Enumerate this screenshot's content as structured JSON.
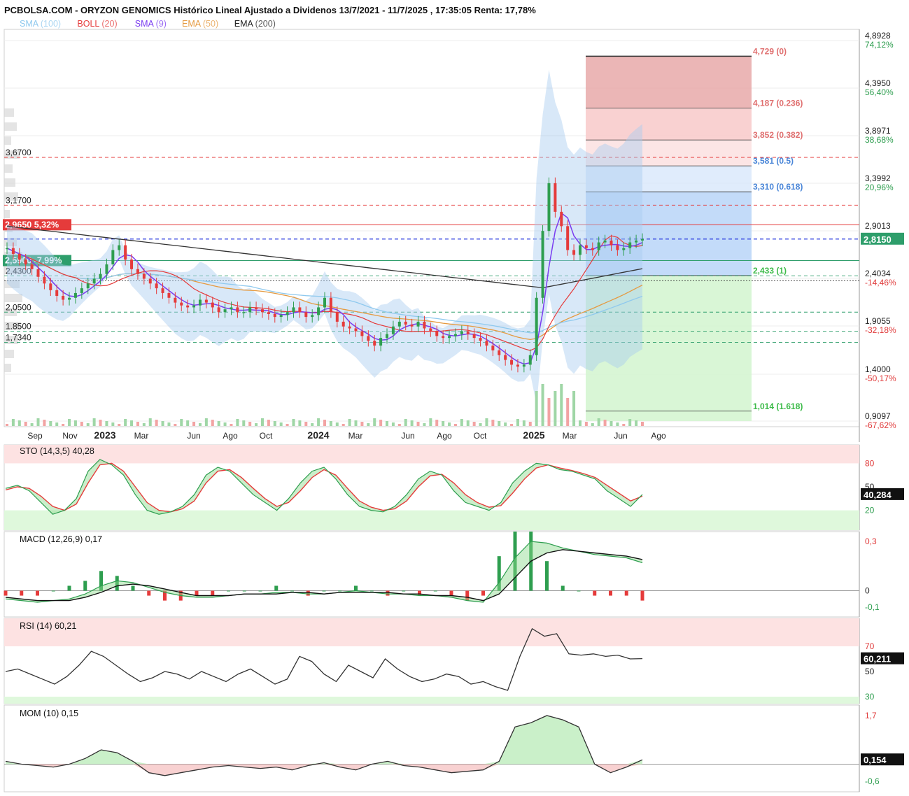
{
  "header": {
    "title": "PCBOLSA.COM - ORYZON GENOMICS Histórico Lineal Ajustado a Dividenos 13/7/2021 - 11/7/2025 , 17:35:05 Renta: 17,78%"
  },
  "legend": [
    {
      "label": "SMA",
      "param": "(100)",
      "color": "#8fc9ee"
    },
    {
      "label": "BOLL",
      "param": "(20)",
      "color": "#e53b3b"
    },
    {
      "label": "SMA",
      "param": "(9)",
      "color": "#7a3cf0"
    },
    {
      "label": "EMA",
      "param": "(50)",
      "color": "#e59a40"
    },
    {
      "label": "EMA",
      "param": "(200)",
      "color": "#222222"
    }
  ],
  "colors": {
    "up": "#2e9e4f",
    "down": "#e53b3b",
    "boll_fill": "#a9cbef",
    "price_tag": "#2e9e6b"
  },
  "chart_data": {
    "type": "candlestick",
    "main": {
      "x_labels": [
        {
          "t": "Sep",
          "bold": false
        },
        {
          "t": "Nov",
          "bold": false
        },
        {
          "t": "2023",
          "bold": true
        },
        {
          "t": "Mar",
          "bold": false
        },
        {
          "t": "Jun",
          "bold": false
        },
        {
          "t": "Ago",
          "bold": false
        },
        {
          "t": "Oct",
          "bold": false
        },
        {
          "t": "2024",
          "bold": true
        },
        {
          "t": "Mar",
          "bold": false
        },
        {
          "t": "Jun",
          "bold": false
        },
        {
          "t": "Ago",
          "bold": false
        },
        {
          "t": "Oct",
          "bold": false
        },
        {
          "t": "2025",
          "bold": true
        },
        {
          "t": "Mar",
          "bold": false
        },
        {
          "t": "Jun",
          "bold": false
        },
        {
          "t": "Ago",
          "bold": false
        }
      ],
      "y_labels": [
        {
          "value": "4,8928",
          "pct": "74,12%"
        },
        {
          "value": "4,3950",
          "pct": "56,40%"
        },
        {
          "value": "3,8971",
          "pct": "38,68%"
        },
        {
          "value": "3,3992",
          "pct": "20,96%"
        },
        {
          "value": "2,9013",
          "pct": ""
        },
        {
          "value": "2,4034",
          "pct": "-14,46%"
        },
        {
          "value": "1,9055",
          "pct": "-32,18%"
        },
        {
          "value": "1,4000",
          "pct": "-50,17%"
        },
        {
          "value": "0,9097",
          "pct": "-67,62%"
        }
      ],
      "last_price": "2,8150",
      "left_levels": [
        {
          "label": "3,6700",
          "value": 3.67
        },
        {
          "label": "3,1700",
          "value": 3.17
        },
        {
          "label": "2,4300",
          "value": 2.43
        },
        {
          "label": "2,0500",
          "value": 2.05
        },
        {
          "label": "1.8500",
          "value": 1.85
        },
        {
          "label": "1,7340",
          "value": 1.734
        }
      ],
      "tags": [
        {
          "text": "2,9650  5,32%",
          "value": 2.965
        },
        {
          "text": "2,5900  -7,99%",
          "value": 2.59
        }
      ],
      "fibonacci": [
        {
          "label": "4,729 (0)",
          "value": 4.729
        },
        {
          "label": "4,187 (0.236)",
          "value": 4.187
        },
        {
          "label": "3,852 (0.382)",
          "value": 3.852
        },
        {
          "label": "3,581 (0.5)",
          "value": 3.581
        },
        {
          "label": "3,310 (0.618)",
          "value": 3.31
        },
        {
          "label": "2,433 (1)",
          "value": 2.433
        },
        {
          "label": "1,014 (1.618)",
          "value": 1.014
        }
      ],
      "close_series": [
        2.72,
        2.66,
        2.6,
        2.55,
        2.5,
        2.42,
        2.35,
        2.28,
        2.22,
        2.18,
        2.2,
        2.25,
        2.3,
        2.35,
        2.4,
        2.45,
        2.55,
        2.7,
        2.75,
        2.6,
        2.5,
        2.45,
        2.4,
        2.35,
        2.3,
        2.25,
        2.2,
        2.15,
        2.12,
        2.1,
        2.12,
        2.18,
        2.15,
        2.1,
        2.05,
        2.08,
        2.1,
        2.05,
        2.05,
        2.1,
        2.08,
        2.05,
        2.03,
        2.0,
        2.02,
        2.05,
        2.1,
        2.05,
        2.0,
        2.02,
        2.1,
        2.2,
        2.05,
        1.95,
        1.9,
        1.88,
        1.85,
        1.8,
        1.75,
        1.7,
        1.78,
        1.82,
        1.9,
        1.95,
        1.92,
        1.9,
        1.95,
        1.88,
        1.85,
        1.8,
        1.78,
        1.8,
        1.82,
        1.85,
        1.82,
        1.78,
        1.75,
        1.7,
        1.65,
        1.6,
        1.55,
        1.5,
        1.48,
        1.5,
        1.6,
        2.2,
        2.9,
        3.4,
        3.1,
        2.95,
        2.7,
        2.65,
        2.75,
        2.72,
        2.7,
        2.78,
        2.8,
        2.75,
        2.7,
        2.72,
        2.78,
        2.8,
        2.815
      ]
    },
    "indicators": [
      {
        "name": "STO",
        "params": "(14,3,5)",
        "value": "40,28",
        "last": "40,284",
        "levels": [
          "80",
          "50",
          "20"
        ],
        "k_series": [
          48,
          52,
          45,
          30,
          15,
          20,
          35,
          70,
          85,
          78,
          65,
          40,
          20,
          15,
          18,
          25,
          40,
          65,
          75,
          70,
          55,
          40,
          30,
          20,
          35,
          55,
          70,
          75,
          60,
          40,
          25,
          20,
          18,
          25,
          40,
          60,
          70,
          65,
          45,
          30,
          25,
          20,
          30,
          55,
          70,
          80,
          78,
          72,
          70,
          65,
          60,
          45,
          35,
          25,
          40.28
        ],
        "d_series": [
          46,
          50,
          48,
          38,
          25,
          20,
          28,
          55,
          78,
          80,
          70,
          50,
          30,
          20,
          18,
          22,
          32,
          55,
          70,
          72,
          62,
          48,
          35,
          25,
          30,
          45,
          62,
          72,
          65,
          48,
          32,
          24,
          20,
          22,
          32,
          50,
          64,
          66,
          55,
          40,
          30,
          24,
          26,
          42,
          60,
          74,
          78,
          74,
          71,
          67,
          62,
          52,
          42,
          32,
          38
        ]
      },
      {
        "name": "MACD",
        "params": "(12,26,9)",
        "value": "0,17",
        "levels": [
          "0,3",
          "0",
          "-0,1"
        ],
        "macd_series": [
          -0.05,
          -0.06,
          -0.07,
          -0.06,
          -0.05,
          -0.02,
          0.03,
          0.06,
          0.05,
          0.02,
          -0.01,
          -0.03,
          -0.04,
          -0.04,
          -0.03,
          -0.02,
          -0.02,
          -0.01,
          -0.01,
          -0.02,
          -0.02,
          -0.01,
          0.0,
          -0.01,
          -0.02,
          -0.02,
          -0.03,
          -0.03,
          -0.04,
          -0.06,
          -0.07,
          0.05,
          0.2,
          0.3,
          0.29,
          0.26,
          0.24,
          0.22,
          0.21,
          0.2,
          0.17
        ],
        "signal_series": [
          -0.04,
          -0.05,
          -0.06,
          -0.06,
          -0.06,
          -0.04,
          -0.01,
          0.03,
          0.04,
          0.03,
          0.01,
          -0.01,
          -0.03,
          -0.03,
          -0.03,
          -0.02,
          -0.02,
          -0.02,
          -0.01,
          -0.01,
          -0.02,
          -0.01,
          -0.01,
          -0.01,
          -0.01,
          -0.02,
          -0.02,
          -0.03,
          -0.03,
          -0.04,
          -0.06,
          -0.02,
          0.08,
          0.18,
          0.23,
          0.25,
          0.24,
          0.23,
          0.22,
          0.21,
          0.19
        ]
      },
      {
        "name": "RSI",
        "params": "(14)",
        "value": "60,21",
        "last": "60,211",
        "levels": [
          "70",
          "50",
          "30"
        ],
        "series": [
          50,
          52,
          48,
          44,
          40,
          46,
          55,
          66,
          62,
          55,
          48,
          42,
          45,
          50,
          48,
          44,
          50,
          46,
          42,
          48,
          52,
          46,
          40,
          44,
          62,
          58,
          48,
          42,
          55,
          50,
          45,
          60,
          52,
          46,
          42,
          44,
          48,
          46,
          40,
          42,
          38,
          35,
          62,
          84,
          78,
          80,
          64,
          63,
          64,
          62,
          63,
          60,
          60.21
        ]
      },
      {
        "name": "MOM",
        "params": "(10)",
        "value": "0,15",
        "last": "0,154",
        "levels": [
          "1,7",
          "-0,6"
        ],
        "series": [
          0.1,
          0.0,
          -0.05,
          -0.1,
          0.0,
          0.2,
          0.5,
          0.4,
          0.1,
          -0.3,
          -0.4,
          -0.3,
          -0.2,
          -0.1,
          -0.05,
          -0.1,
          -0.15,
          -0.1,
          -0.2,
          -0.05,
          0.05,
          -0.1,
          -0.2,
          0.0,
          0.1,
          -0.05,
          -0.1,
          -0.2,
          -0.3,
          -0.25,
          -0.2,
          0.1,
          1.3,
          1.45,
          1.7,
          1.55,
          1.3,
          0.0,
          -0.3,
          -0.1,
          0.154
        ]
      }
    ]
  }
}
